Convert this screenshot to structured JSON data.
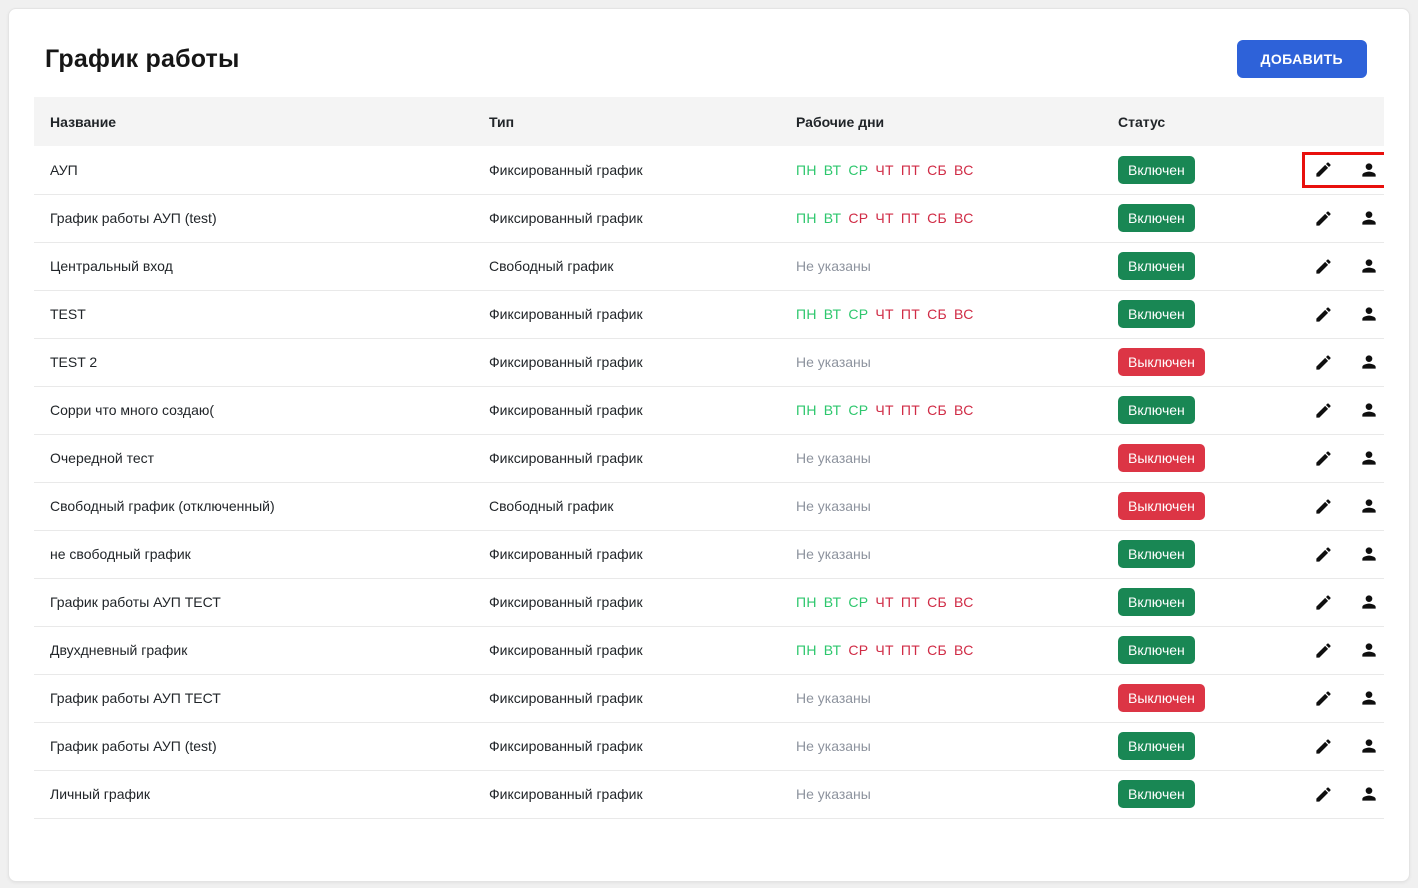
{
  "page": {
    "title": "График работы"
  },
  "toolbar": {
    "add_label": "ДОБАВИТЬ"
  },
  "table": {
    "columns": [
      "Название",
      "Тип",
      "Рабочие дни",
      "Статус"
    ],
    "not_specified": "Не указаны",
    "rows": [
      {
        "name": "АУП",
        "type": "Фиксированный график",
        "days": [
          {
            "d": "ПН",
            "on": true
          },
          {
            "d": "ВТ",
            "on": true
          },
          {
            "d": "СР",
            "on": true
          },
          {
            "d": "ЧТ",
            "on": false
          },
          {
            "d": "ПТ",
            "on": false
          },
          {
            "d": "СБ",
            "on": false
          },
          {
            "d": "ВС",
            "on": false
          }
        ],
        "status": {
          "label": "Включен",
          "on": true
        },
        "highlighted": true
      },
      {
        "name": "График работы АУП (test)",
        "type": "Фиксированный график",
        "days": [
          {
            "d": "ПН",
            "on": true
          },
          {
            "d": "ВТ",
            "on": true
          },
          {
            "d": "СР",
            "on": false
          },
          {
            "d": "ЧТ",
            "on": false
          },
          {
            "d": "ПТ",
            "on": false
          },
          {
            "d": "СБ",
            "on": false
          },
          {
            "d": "ВС",
            "on": false
          }
        ],
        "status": {
          "label": "Включен",
          "on": true
        },
        "highlighted": false
      },
      {
        "name": "Центральный вход",
        "type": "Свободный график",
        "days": [],
        "status": {
          "label": "Включен",
          "on": true
        },
        "highlighted": false
      },
      {
        "name": "TEST",
        "type": "Фиксированный график",
        "days": [
          {
            "d": "ПН",
            "on": true
          },
          {
            "d": "ВТ",
            "on": true
          },
          {
            "d": "СР",
            "on": true
          },
          {
            "d": "ЧТ",
            "on": false
          },
          {
            "d": "ПТ",
            "on": false
          },
          {
            "d": "СБ",
            "on": false
          },
          {
            "d": "ВС",
            "on": false
          }
        ],
        "status": {
          "label": "Включен",
          "on": true
        },
        "highlighted": false
      },
      {
        "name": "TEST 2",
        "type": "Фиксированный график",
        "days": [],
        "status": {
          "label": "Выключен",
          "on": false
        },
        "highlighted": false
      },
      {
        "name": "Сорри что много создаю(",
        "type": "Фиксированный график",
        "days": [
          {
            "d": "ПН",
            "on": true
          },
          {
            "d": "ВТ",
            "on": true
          },
          {
            "d": "СР",
            "on": true
          },
          {
            "d": "ЧТ",
            "on": false
          },
          {
            "d": "ПТ",
            "on": false
          },
          {
            "d": "СБ",
            "on": false
          },
          {
            "d": "ВС",
            "on": false
          }
        ],
        "status": {
          "label": "Включен",
          "on": true
        },
        "highlighted": false
      },
      {
        "name": "Очередной тест",
        "type": "Фиксированный график",
        "days": [],
        "status": {
          "label": "Выключен",
          "on": false
        },
        "highlighted": false
      },
      {
        "name": "Свободный график (отключенный)",
        "type": "Свободный график",
        "days": [],
        "status": {
          "label": "Выключен",
          "on": false
        },
        "highlighted": false
      },
      {
        "name": "не свободный график",
        "type": "Фиксированный график",
        "days": [],
        "status": {
          "label": "Включен",
          "on": true
        },
        "highlighted": false
      },
      {
        "name": "График работы АУП ТЕСТ",
        "type": "Фиксированный график",
        "days": [
          {
            "d": "ПН",
            "on": true
          },
          {
            "d": "ВТ",
            "on": true
          },
          {
            "d": "СР",
            "on": true
          },
          {
            "d": "ЧТ",
            "on": false
          },
          {
            "d": "ПТ",
            "on": false
          },
          {
            "d": "СБ",
            "on": false
          },
          {
            "d": "ВС",
            "on": false
          }
        ],
        "status": {
          "label": "Включен",
          "on": true
        },
        "highlighted": false
      },
      {
        "name": "Двухдневный график",
        "type": "Фиксированный график",
        "days": [
          {
            "d": "ПН",
            "on": true
          },
          {
            "d": "ВТ",
            "on": true
          },
          {
            "d": "СР",
            "on": false
          },
          {
            "d": "ЧТ",
            "on": false
          },
          {
            "d": "ПТ",
            "on": false
          },
          {
            "d": "СБ",
            "on": false
          },
          {
            "d": "ВС",
            "on": false
          }
        ],
        "status": {
          "label": "Включен",
          "on": true
        },
        "highlighted": false
      },
      {
        "name": "График работы АУП ТЕСТ",
        "type": "Фиксированный график",
        "days": [],
        "status": {
          "label": "Выключен",
          "on": false
        },
        "highlighted": false
      },
      {
        "name": "График работы АУП (test)",
        "type": "Фиксированный график",
        "days": [],
        "status": {
          "label": "Включен",
          "on": true
        },
        "highlighted": false
      },
      {
        "name": "Личный график",
        "type": "Фиксированный график",
        "days": [],
        "status": {
          "label": "Включен",
          "on": true
        },
        "highlighted": false
      }
    ]
  },
  "icons": {
    "edit": "pencil-icon",
    "assign": "person-icon"
  },
  "colors": {
    "accent_blue": "#2e62d9",
    "day_on": "#2dc76d",
    "day_off": "#d02b45",
    "badge_on": "#198754",
    "badge_off": "#dc3545",
    "muted": "#8d939e",
    "annotation": "#e8100d"
  }
}
